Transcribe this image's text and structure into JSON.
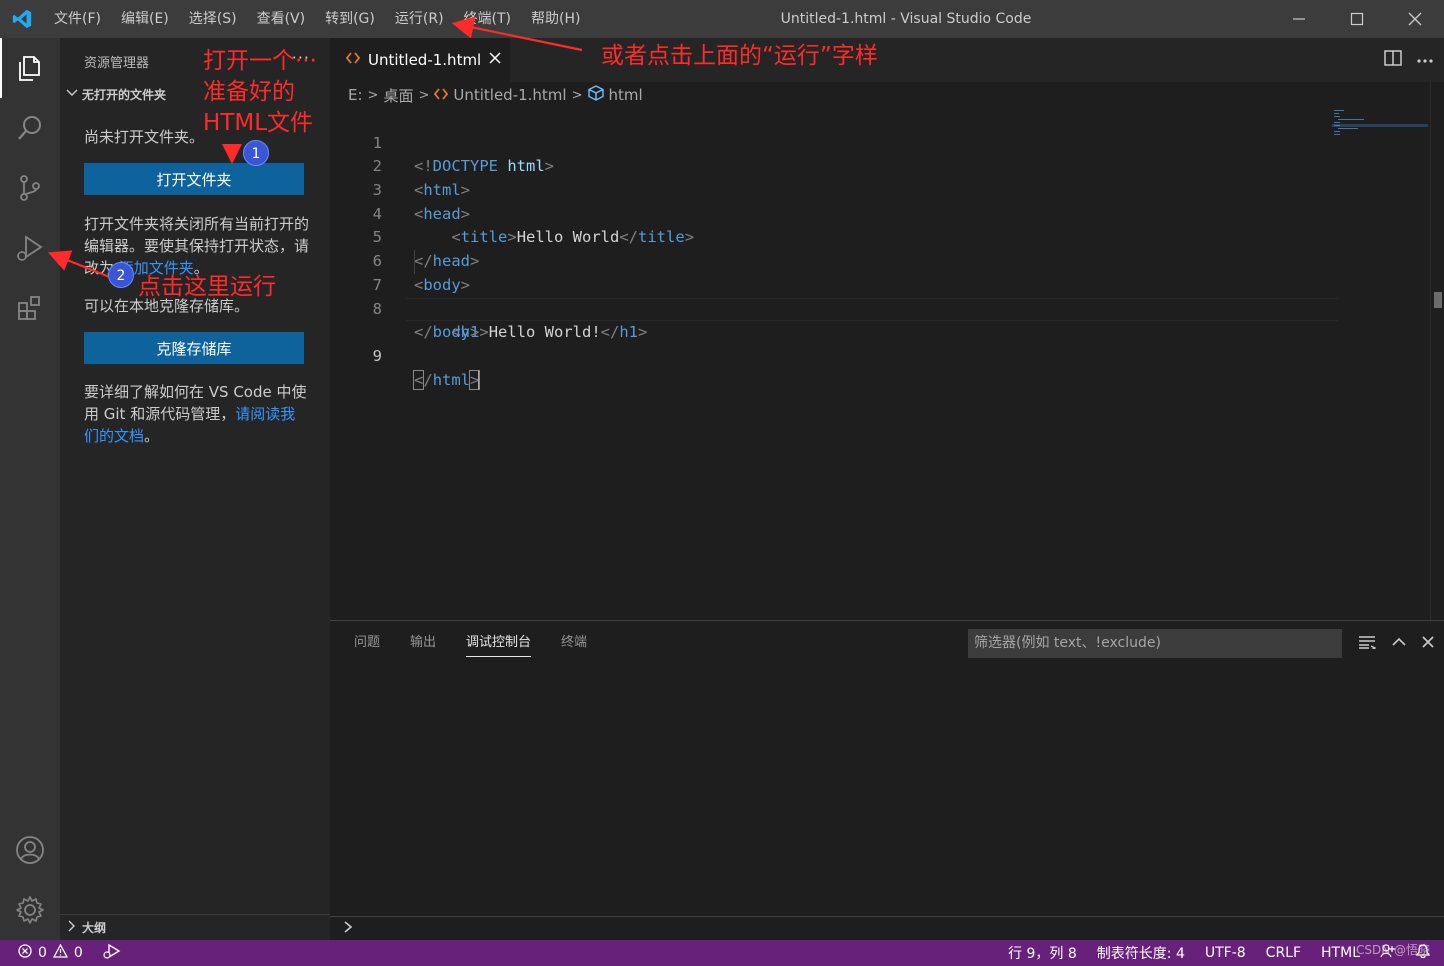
{
  "window": {
    "title": "Untitled-1.html - Visual Studio Code",
    "menu": [
      "文件(F)",
      "编辑(E)",
      "选择(S)",
      "查看(V)",
      "转到(G)",
      "运行(R)",
      "终端(T)",
      "帮助(H)"
    ]
  },
  "activity_bar": {
    "icons": [
      "explorer-icon",
      "search-icon",
      "source-control-icon",
      "run-debug-icon",
      "extensions-icon",
      "account-icon",
      "settings-gear-icon"
    ],
    "active": "explorer-icon"
  },
  "sidebar": {
    "title": "资源管理器",
    "more": "···",
    "section": "无打开的文件夹",
    "no_folder_text": "尚未打开文件夹。",
    "open_folder_button": "打开文件夹",
    "open_folder_note_1": "打开文件夹将关闭所有当前打开的编辑器。要使其保持打开状态，请改为 ",
    "open_folder_note_link": "添加文件夹",
    "open_folder_note_2": "。",
    "clone_text": "可以在本地克隆存储库。",
    "clone_button": "克隆存储库",
    "learn_text_1": "要详细了解如何在 VS Code 中使用 Git 和源代码管理，",
    "learn_link": "请阅读我们的文档",
    "learn_text_2": "。",
    "outline": "大纲"
  },
  "editor": {
    "tab_label": "Untitled-1.html",
    "breadcrumbs": {
      "drive": "E:",
      "folder": "桌面",
      "file": "Untitled-1.html",
      "symbol": "html"
    },
    "line_numbers": [
      "1",
      "2",
      "3",
      "4",
      "5",
      "6",
      "7",
      "8",
      "9"
    ],
    "current_line": 9,
    "code": {
      "l1_doctype": "DOCTYPE",
      "l1_html": "html",
      "l2_tag": "html",
      "l3_tag": "head",
      "l4_tag": "title",
      "l4_text": "Hello World",
      "l5_tag": "head",
      "l6_tag": "body",
      "l7_tag": "h1",
      "l7_text": "Hello World!",
      "l8_tag": "body",
      "l9_tag": "html"
    }
  },
  "panel": {
    "tabs": [
      "问题",
      "输出",
      "调试控制台",
      "终端"
    ],
    "active_tab": "调试控制台",
    "filter_placeholder": "筛选器(例如 text、!exclude)"
  },
  "statusbar": {
    "errors": "0",
    "warnings": "0",
    "position": "行 9，列 8",
    "indent": "制表符长度: 4",
    "encoding": "UTF-8",
    "eol": "CRLF",
    "language": "HTML",
    "color": "#68217a"
  },
  "watermark": "CSDN @悟晓",
  "annotations": {
    "open_folder_hint": [
      "打开一个···",
      "准备好的",
      "HTML文件"
    ],
    "badge_1": "1",
    "badge_2": "2",
    "run_here": "点击这里运行",
    "or_menu": "或者点击上面的“运行”字样",
    "color": "#ff2a2a"
  }
}
